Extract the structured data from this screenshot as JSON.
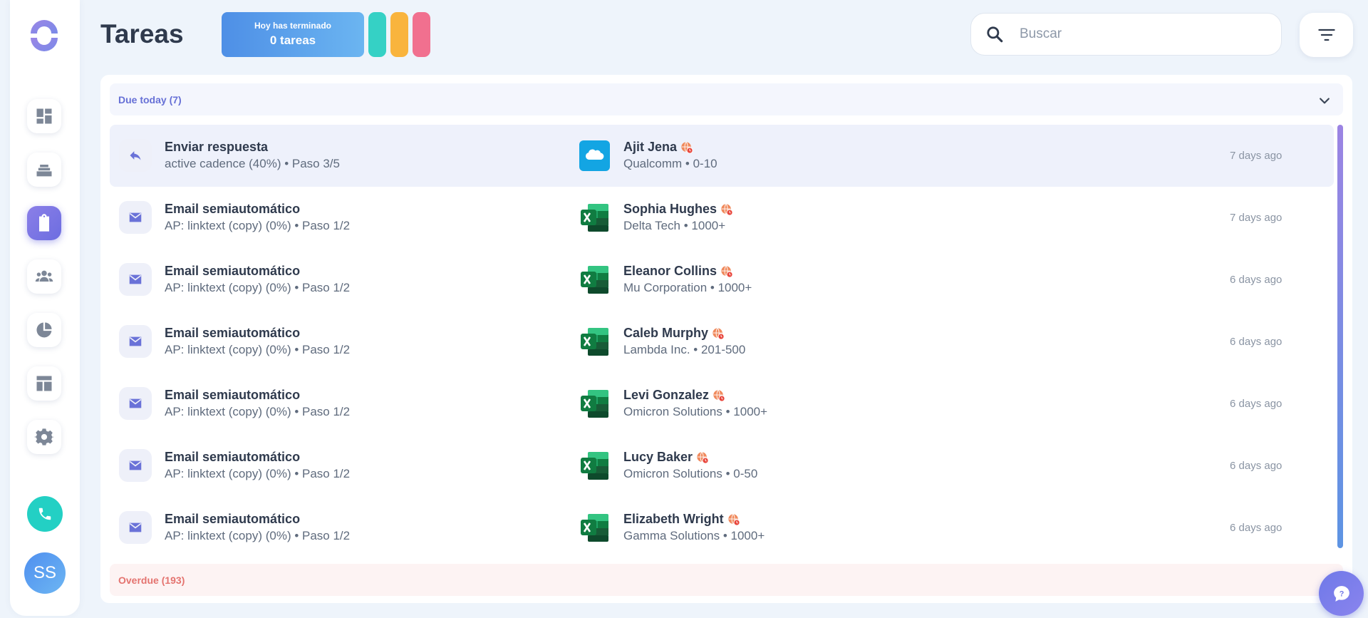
{
  "header": {
    "title": "Tareas",
    "done_label": "Hoy has terminado",
    "done_value": "0 tareas",
    "pills": [
      "#35d1c5",
      "#f9b43d",
      "#f1708f"
    ]
  },
  "search": {
    "placeholder": "Buscar",
    "value": ""
  },
  "sidebar": {
    "items": [
      {
        "icon": "dashboard-icon"
      },
      {
        "icon": "stack-icon"
      },
      {
        "icon": "clipboard-icon",
        "active": true
      },
      {
        "icon": "people-icon"
      },
      {
        "icon": "pie-chart-icon"
      },
      {
        "icon": "layout-icon"
      },
      {
        "icon": "gear-icon"
      }
    ],
    "avatar": "SS"
  },
  "groups": {
    "due": "Due today (7)",
    "overdue": "Overdue (193)"
  },
  "tasks": [
    {
      "title": "Enviar respuesta",
      "sub": "active cadence (40%) • Paso 3/5",
      "icon": "reply-icon",
      "source": "salesforce",
      "name": "Ajit Jena",
      "company": "Qualcomm • 0-10",
      "time": "7 days ago"
    },
    {
      "title": "Email semiautomático",
      "sub": "AP: linktext (copy) (0%) • Paso 1/2",
      "icon": "mail-icon",
      "source": "excel",
      "name": "Sophia Hughes",
      "company": "Delta Tech • 1000+",
      "time": "7 days ago"
    },
    {
      "title": "Email semiautomático",
      "sub": "AP: linktext (copy) (0%) • Paso 1/2",
      "icon": "mail-icon",
      "source": "excel",
      "name": "Eleanor Collins",
      "company": "Mu Corporation • 1000+",
      "time": "6 days ago"
    },
    {
      "title": "Email semiautomático",
      "sub": "AP: linktext (copy) (0%) • Paso 1/2",
      "icon": "mail-icon",
      "source": "excel",
      "name": "Caleb Murphy",
      "company": "Lambda Inc. • 201-500",
      "time": "6 days ago"
    },
    {
      "title": "Email semiautomático",
      "sub": "AP: linktext (copy) (0%) • Paso 1/2",
      "icon": "mail-icon",
      "source": "excel",
      "name": "Levi Gonzalez",
      "company": "Omicron Solutions • 1000+",
      "time": "6 days ago"
    },
    {
      "title": "Email semiautomático",
      "sub": "AP: linktext (copy) (0%) • Paso 1/2",
      "icon": "mail-icon",
      "source": "excel",
      "name": "Lucy Baker",
      "company": "Omicron Solutions • 0-50",
      "time": "6 days ago"
    },
    {
      "title": "Email semiautomático",
      "sub": "AP: linktext (copy) (0%) • Paso 1/2",
      "icon": "mail-icon",
      "source": "excel",
      "name": "Elizabeth Wright",
      "company": "Gamma Solutions • 1000+",
      "time": "6 days ago"
    }
  ],
  "colors": {
    "accent": "#6c6de0",
    "due_text": "#6670d6",
    "overdue_text": "#e4736f",
    "phone": "#23d0c4"
  }
}
